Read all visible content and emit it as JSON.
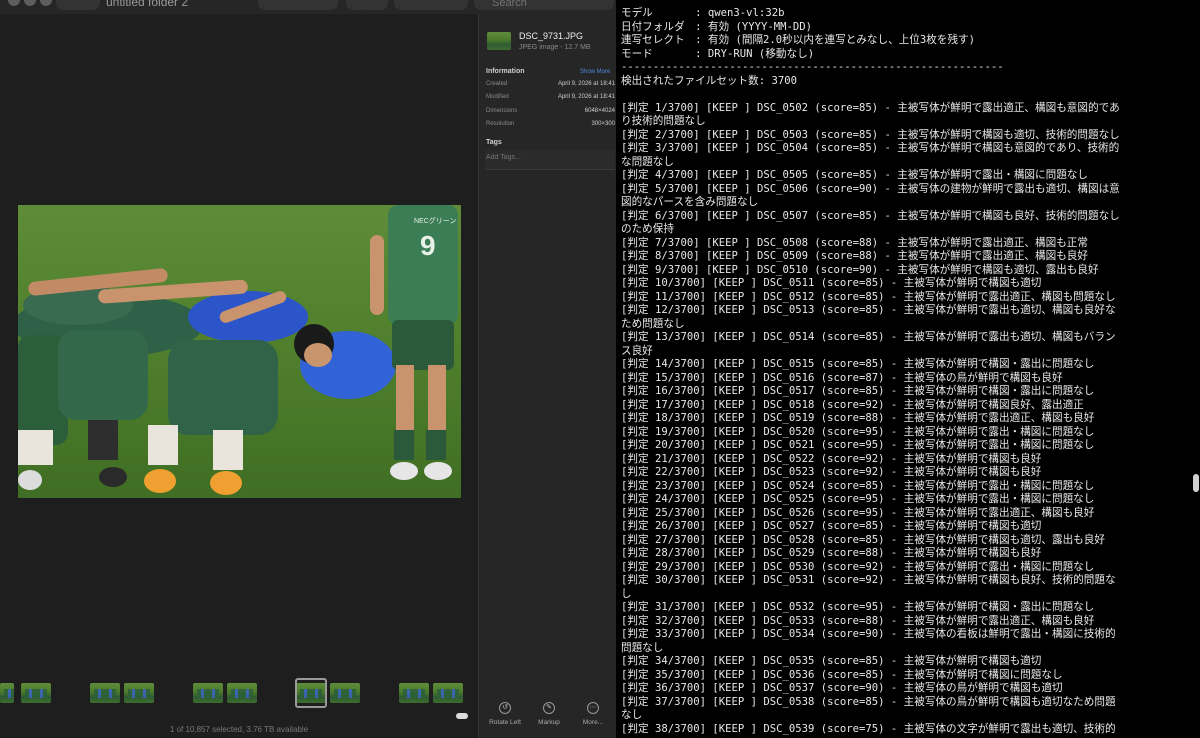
{
  "finder": {
    "folder_title": "untitled folder 2",
    "search_placeholder": "Search",
    "status_text": "1 of 10,857 selected, 3.76 TB available",
    "inspector": {
      "file_name": "DSC_9731.JPG",
      "file_kind": "JPEG image - 12.7 MB",
      "information_heading": "Information",
      "show_more": "Show More",
      "info_rows": [
        {
          "label": "Created",
          "value": "April 9, 2026 at 18:41"
        },
        {
          "label": "Modified",
          "value": "April 9, 2026 at 18:41"
        },
        {
          "label": "Dimensions",
          "value": "6048×4024"
        },
        {
          "label": "Resolution",
          "value": "300×300"
        }
      ],
      "tags_heading": "Tags",
      "tags_placeholder": "Add Tags...",
      "actions": [
        {
          "label": "Rotate Left",
          "icon": "rotate-left-icon"
        },
        {
          "label": "Markup",
          "icon": "markup-icon"
        },
        {
          "label": "More...",
          "icon": "more-icon"
        }
      ]
    },
    "photo": {
      "jersey_text": "NECグリーン",
      "jersey_number": "9"
    }
  },
  "terminal": {
    "lines": [
      "モデル　　　　: qwen3-vl:32b",
      "日付フォルダ　: 有効 (YYYY-MM-DD)",
      "連写セレクト　: 有効 (間隔2.0秒以内を連写とみなし、上位3枚を残す)",
      "モード　　　　: DRY-RUN (移動なし)",
      "------------------------------------------------------------",
      "検出されたファイルセット数: 3700",
      "",
      "[判定 1/3700] [KEEP  ] DSC_0502 (score=85) - 主被写体が鮮明で露出適正、構図も意図的であ",
      "り技術的問題なし",
      "[判定 2/3700] [KEEP  ] DSC_0503 (score=85) - 主被写体が鮮明で構図も適切、技術的問題なし",
      "[判定 3/3700] [KEEP  ] DSC_0504 (score=85) - 主被写体が鮮明で構図も意図的であり、技術的",
      "な問題なし",
      "[判定 4/3700] [KEEP  ] DSC_0505 (score=85) - 主被写体が鮮明で露出・構図に問題なし",
      "[判定 5/3700] [KEEP  ] DSC_0506 (score=90) - 主被写体の建物が鮮明で露出も適切、構図は意",
      "図的なパースを含み問題なし",
      "[判定 6/3700] [KEEP  ] DSC_0507 (score=85) - 主被写体が鮮明で構図も良好、技術的問題なし",
      "のため保持",
      "[判定 7/3700] [KEEP  ] DSC_0508 (score=88) - 主被写体が鮮明で露出適正、構図も正常",
      "[判定 8/3700] [KEEP  ] DSC_0509 (score=88) - 主被写体が鮮明で露出適正、構図も良好",
      "[判定 9/3700] [KEEP  ] DSC_0510 (score=90) - 主被写体が鮮明で構図も適切、露出も良好",
      "[判定 10/3700] [KEEP  ] DSC_0511 (score=85) - 主被写体が鮮明で構図も適切",
      "[判定 11/3700] [KEEP  ] DSC_0512 (score=85) - 主被写体が鮮明で露出適正、構図も問題なし",
      "[判定 12/3700] [KEEP  ] DSC_0513 (score=85) - 主被写体が鮮明で露出も適切、構図も良好な",
      "ため問題なし",
      "[判定 13/3700] [KEEP  ] DSC_0514 (score=85) - 主被写体が鮮明で露出も適切、構図もバラン",
      "ス良好",
      "[判定 14/3700] [KEEP  ] DSC_0515 (score=85) - 主被写体が鮮明で構図・露出に問題なし",
      "[判定 15/3700] [KEEP  ] DSC_0516 (score=87) - 主被写体の鳥が鮮明で構図も良好",
      "[判定 16/3700] [KEEP  ] DSC_0517 (score=85) - 主被写体が鮮明で構図・露出に問題なし",
      "[判定 17/3700] [KEEP  ] DSC_0518 (score=92) - 主被写体が鮮明で構図良好、露出適正",
      "[判定 18/3700] [KEEP  ] DSC_0519 (score=88) - 主被写体が鮮明で露出適正、構図も良好",
      "[判定 19/3700] [KEEP  ] DSC_0520 (score=95) - 主被写体が鮮明で露出・構図に問題なし",
      "[判定 20/3700] [KEEP  ] DSC_0521 (score=95) - 主被写体が鮮明で露出・構図に問題なし",
      "[判定 21/3700] [KEEP  ] DSC_0522 (score=92) - 主被写体が鮮明で構図も良好",
      "[判定 22/3700] [KEEP  ] DSC_0523 (score=92) - 主被写体が鮮明で構図も良好",
      "[判定 23/3700] [KEEP  ] DSC_0524 (score=85) - 主被写体が鮮明で露出・構図に問題なし",
      "[判定 24/3700] [KEEP  ] DSC_0525 (score=95) - 主被写体が鮮明で露出・構図に問題なし",
      "[判定 25/3700] [KEEP  ] DSC_0526 (score=95) - 主被写体が鮮明で露出適正、構図も良好",
      "[判定 26/3700] [KEEP  ] DSC_0527 (score=85) - 主被写体が鮮明で構図も適切",
      "[判定 27/3700] [KEEP  ] DSC_0528 (score=85) - 主被写体が鮮明で構図も適切、露出も良好",
      "[判定 28/3700] [KEEP  ] DSC_0529 (score=88) - 主被写体が鮮明で構図も良好",
      "[判定 29/3700] [KEEP  ] DSC_0530 (score=92) - 主被写体が鮮明で露出・構図に問題なし",
      "[判定 30/3700] [KEEP  ] DSC_0531 (score=92) - 主被写体が鮮明で構図も良好、技術的問題な",
      "し",
      "[判定 31/3700] [KEEP  ] DSC_0532 (score=95) - 主被写体が鮮明で構図・露出に問題なし",
      "[判定 32/3700] [KEEP  ] DSC_0533 (score=88) - 主被写体が鮮明で露出適正、構図も良好",
      "[判定 33/3700] [KEEP  ] DSC_0534 (score=90) - 主被写体の看板は鮮明で露出・構図に技術的",
      "問題なし",
      "[判定 34/3700] [KEEP  ] DSC_0535 (score=85) - 主被写体が鮮明で構図も適切",
      "[判定 35/3700] [KEEP  ] DSC_0536 (score=85) - 主被写体が鮮明で構図に問題なし",
      "[判定 36/3700] [KEEP  ] DSC_0537 (score=90) - 主被写体の鳥が鮮明で構図も適切",
      "[判定 37/3700] [KEEP  ] DSC_0538 (score=85) - 主被写体の鳥が鮮明で構図も適切なため問題",
      "なし",
      "[判定 38/3700] [KEEP  ] DSC_0539 (score=75) - 主被写体の文字が鮮明で露出も適切、技術的"
    ]
  }
}
